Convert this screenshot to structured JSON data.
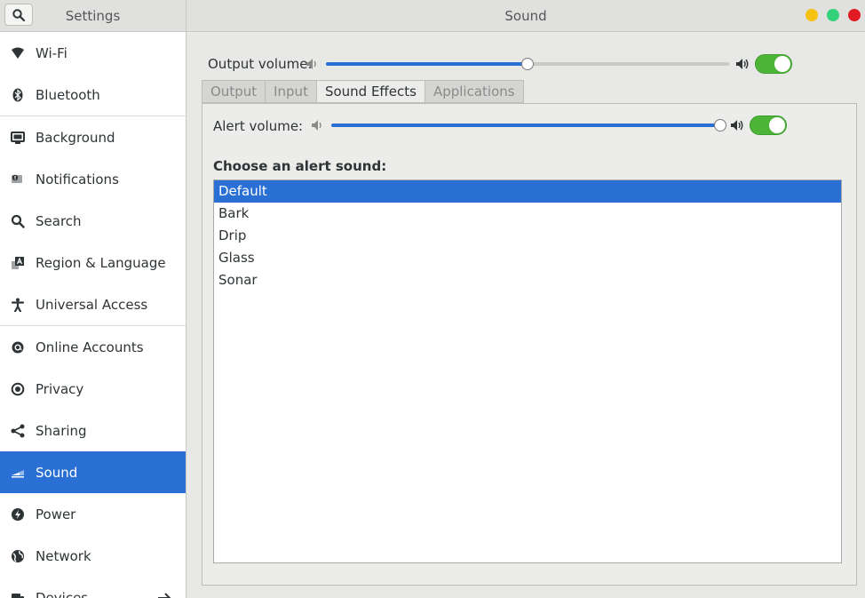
{
  "header": {
    "left_title": "Settings",
    "main_title": "Sound"
  },
  "sidebar": {
    "items": [
      {
        "label": "Wi-Fi",
        "icon": "wifi-icon"
      },
      {
        "label": "Bluetooth",
        "icon": "bluetooth-icon"
      },
      {
        "label": "Background",
        "icon": "monitor-icon"
      },
      {
        "label": "Notifications",
        "icon": "notifications-icon"
      },
      {
        "label": "Search",
        "icon": "search-icon"
      },
      {
        "label": "Region & Language",
        "icon": "region-language-icon"
      },
      {
        "label": "Universal Access",
        "icon": "universal-access-icon"
      },
      {
        "label": "Online Accounts",
        "icon": "at-sign-icon"
      },
      {
        "label": "Privacy",
        "icon": "privacy-icon"
      },
      {
        "label": "Sharing",
        "icon": "share-icon"
      },
      {
        "label": "Sound",
        "icon": "sound-icon",
        "selected": true
      },
      {
        "label": "Power",
        "icon": "power-icon"
      },
      {
        "label": "Network",
        "icon": "network-icon"
      },
      {
        "label": "Devices",
        "icon": "devices-icon"
      }
    ]
  },
  "main": {
    "output_volume_label": "Output volume:",
    "output_volume_level": 0.5,
    "output_enabled": true,
    "tabs": [
      {
        "label": "Output"
      },
      {
        "label": "Input"
      },
      {
        "label": "Sound Effects",
        "active": true
      },
      {
        "label": "Applications"
      }
    ],
    "alert_volume_label": "Alert volume:",
    "alert_volume_level": 1.0,
    "alert_enabled": true,
    "choose_label": "Choose an alert sound:",
    "sounds": [
      {
        "label": "Default",
        "selected": true
      },
      {
        "label": "Bark"
      },
      {
        "label": "Drip"
      },
      {
        "label": "Glass"
      },
      {
        "label": "Sonar"
      }
    ]
  },
  "colors": {
    "accent": "#2a6fd4",
    "switch_on": "#4cb538"
  }
}
